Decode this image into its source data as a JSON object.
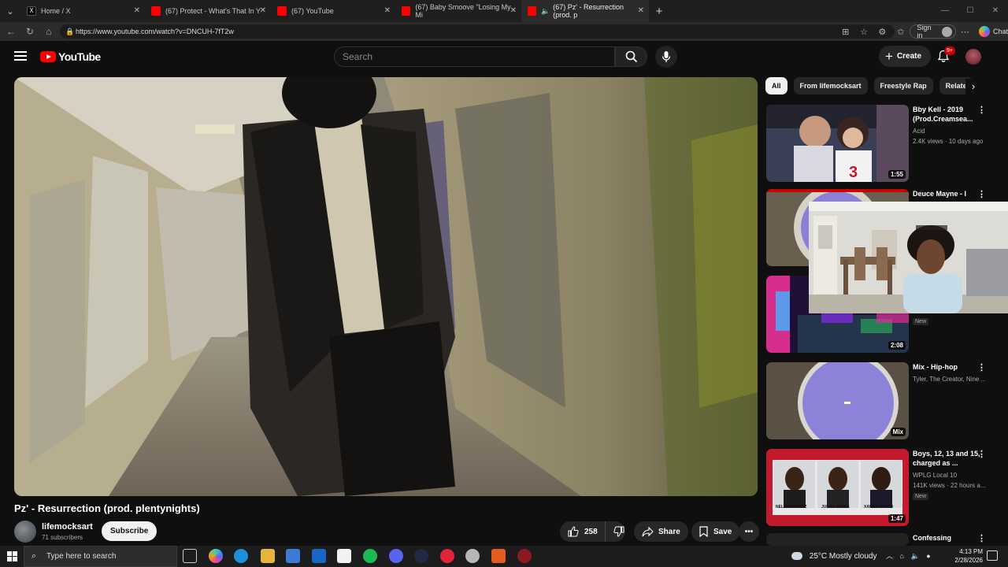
{
  "browser": {
    "tabs": [
      {
        "label": "Home / X",
        "icon": "x-logo-icon",
        "color": "#000000",
        "active": false
      },
      {
        "label": "(67) Protect - What's That In Y",
        "icon": "youtube-icon",
        "color": "#ff0000",
        "active": false
      },
      {
        "label": "(67) YouTube",
        "icon": "youtube-icon",
        "color": "#ff0000",
        "active": false
      },
      {
        "label": "(67) Baby Smoove \"Losing My Mi",
        "icon": "youtube-icon",
        "color": "#ff0000",
        "active": false
      },
      {
        "label": "(67) Pz' - Resurrection (prod. p",
        "icon": "youtube-icon",
        "color": "#ff0000",
        "active": true
      }
    ],
    "url": "https://www.youtube.com/watch?v=DNCUH-7fT2w",
    "signin_label": "Sign in",
    "chat_label": "Chat"
  },
  "youtube": {
    "logo_text": "YouTube",
    "search_placeholder": "Search",
    "create_label": "Create",
    "notification_count": "9+"
  },
  "video": {
    "title": "Pz' - Resurrection (prod. plentynights)",
    "channel_name": "lifemocksart",
    "subscribers": "71 subscribers",
    "subscribe_label": "Subscribe",
    "likes": "258",
    "share_label": "Share",
    "save_label": "Save"
  },
  "chips": [
    "All",
    "From lifemocksart",
    "Freestyle Rap",
    "Relate"
  ],
  "recommendations": [
    {
      "title": "Bby Kell - 2019 (Prod.Creamsea...",
      "channel": "Acid",
      "meta": "2.4K views · 10 days ago",
      "duration": "1:55",
      "badge": ""
    },
    {
      "title": "Deuce Mayne - I",
      "channel": "",
      "meta": "",
      "duration": "",
      "badge": ""
    },
    {
      "title": "",
      "channel": "",
      "meta": "",
      "duration": "2:08",
      "badge": "New"
    },
    {
      "title": "Mix - Hip-hop",
      "channel": "Tyler, The Creator, Nine ...",
      "meta": "",
      "duration": "Mix",
      "badge": ""
    },
    {
      "title": "Boys, 12, 13 and 15, charged as ...",
      "channel": "WPLG Local 10",
      "meta": "141K views · 22 hours a...",
      "duration": "1:47",
      "badge": "New"
    },
    {
      "title": "Confessing",
      "channel": "",
      "meta": "",
      "duration": "",
      "badge": ""
    }
  ],
  "mugshot_labels": [
    "NELSON NUNEZ",
    "JUDAH JONES",
    "XAVIER TYSON"
  ],
  "taskbar": {
    "search_placeholder": "Type here to search",
    "temperature": "25°C",
    "weather": "Mostly cloudy",
    "time": "4:13 PM",
    "date": "2/28/2026"
  }
}
